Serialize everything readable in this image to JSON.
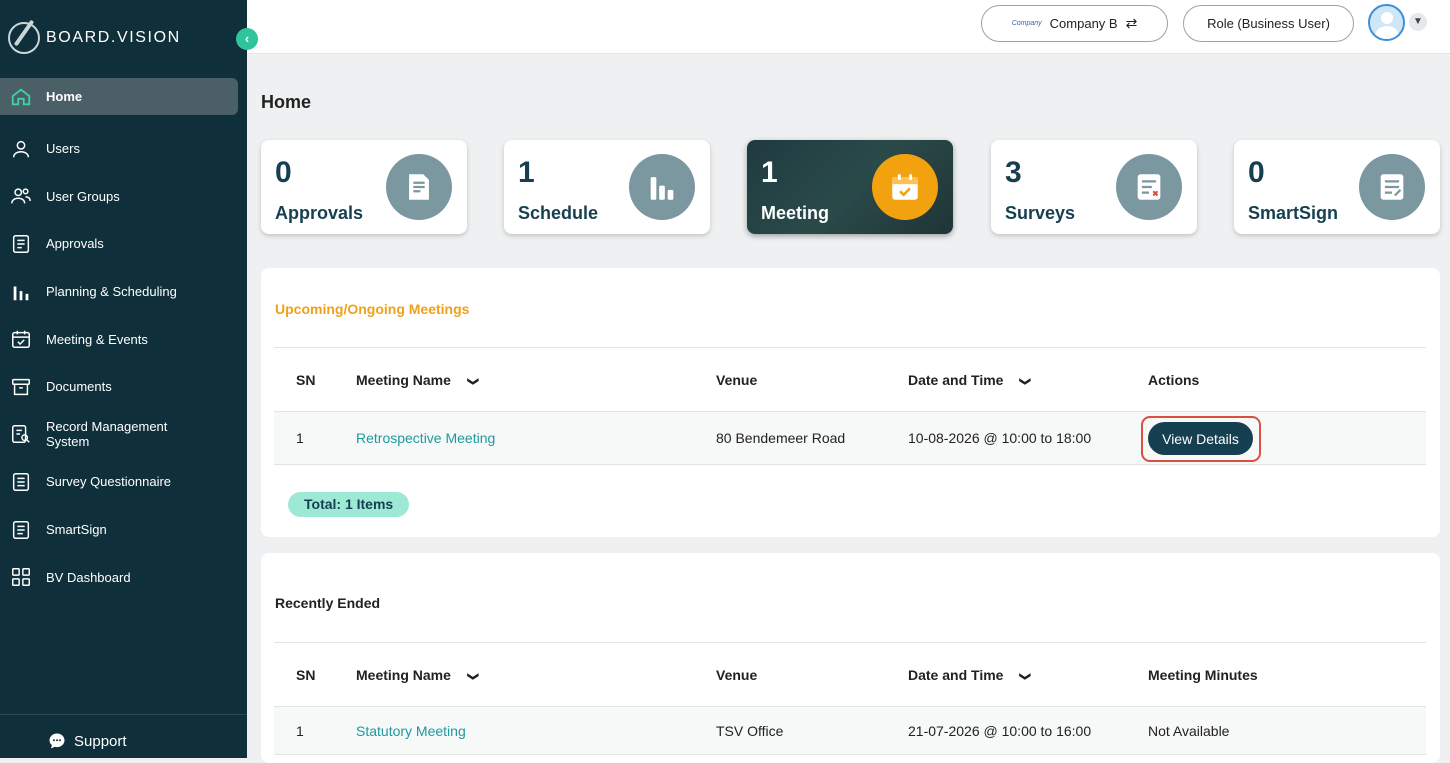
{
  "brand": {
    "name": "BOARD.VISION"
  },
  "sidebar": {
    "collapse_glyph": "‹",
    "items": [
      {
        "label": "Home",
        "icon": "home-icon"
      },
      {
        "label": "Users",
        "icon": "user-icon"
      },
      {
        "label": "User Groups",
        "icon": "user-group-icon"
      },
      {
        "label": "Approvals",
        "icon": "approvals-icon"
      },
      {
        "label": "Planning & Scheduling",
        "icon": "bar-chart-icon"
      },
      {
        "label": "Meeting & Events",
        "icon": "calendar-check-icon"
      },
      {
        "label": "Documents",
        "icon": "archive-icon"
      },
      {
        "label": "Record Management System",
        "icon": "record-search-icon"
      },
      {
        "label": "Survey Questionnaire",
        "icon": "survey-icon"
      },
      {
        "label": "SmartSign",
        "icon": "smartsign-icon"
      },
      {
        "label": "BV Dashboard",
        "icon": "dashboard-grid-icon"
      }
    ],
    "support_label": "Support"
  },
  "topbar": {
    "company_logo_text": "Company",
    "company_label": "Company B",
    "role_label": "Role (Business User)"
  },
  "page": {
    "title": "Home"
  },
  "cards": [
    {
      "count": "0",
      "label": "Approvals",
      "icon": "document-icon"
    },
    {
      "count": "1",
      "label": "Schedule",
      "icon": "bar-chart-icon"
    },
    {
      "count": "1",
      "label": "Meeting",
      "icon": "calendar-check-icon"
    },
    {
      "count": "3",
      "label": "Surveys",
      "icon": "checklist-icon"
    },
    {
      "count": "0",
      "label": "SmartSign",
      "icon": "sign-document-icon"
    }
  ],
  "upcoming": {
    "title": "Upcoming/Ongoing Meetings",
    "title_color": "#f0a11a",
    "columns": {
      "sn": "SN",
      "name": "Meeting Name",
      "venue": "Venue",
      "date": "Date and Time",
      "actions": "Actions"
    },
    "rows": [
      {
        "sn": "1",
        "name": "Retrospective Meeting",
        "venue": "80 Bendemeer Road",
        "date": "10-08-2026 @ 10:00 to 18:00",
        "action": "View Details"
      }
    ],
    "total": "Total: 1 Items"
  },
  "ended": {
    "title": "Recently Ended",
    "columns": {
      "sn": "SN",
      "name": "Meeting Name",
      "venue": "Venue",
      "date": "Date and Time",
      "minutes": "Meeting Minutes"
    },
    "rows": [
      {
        "sn": "1",
        "name": "Statutory Meeting",
        "venue": "TSV Office",
        "date": "21-07-2026 @ 10:00 to 16:00",
        "minutes": "Not Available"
      }
    ]
  },
  "colors": {
    "sidebar": "#0f2f3a",
    "accent": "#2fc49a",
    "link": "#1d9aa0",
    "primary": "#173f52",
    "highlight": "#d9503f"
  }
}
